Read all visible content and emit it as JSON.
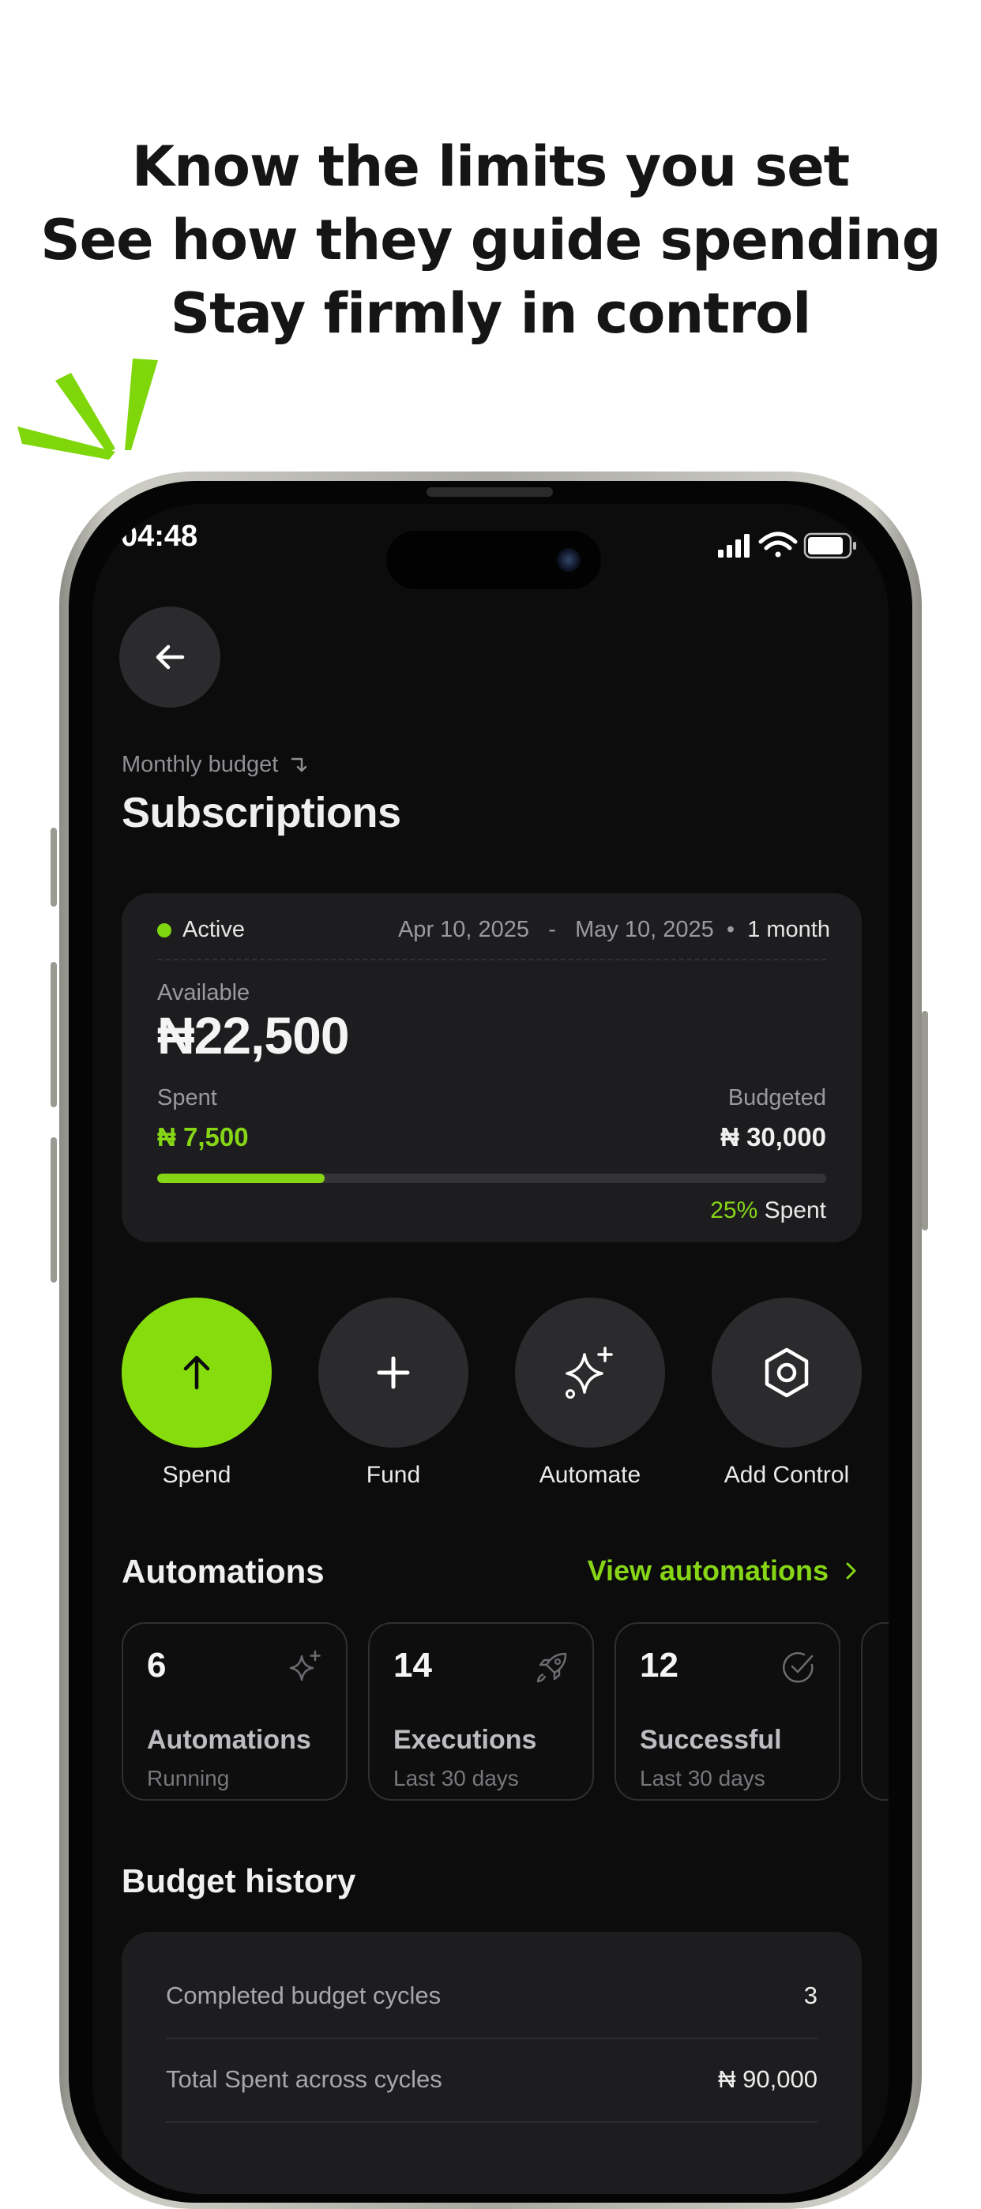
{
  "headline": {
    "line1": "Know the limits you set",
    "line2": "See how they guide spending",
    "line3": "Stay firmly in control"
  },
  "colors": {
    "accent": "#86d616",
    "background": "#0c0c0d",
    "card": "#1d1d1f"
  },
  "status_bar": {
    "time": "04:48",
    "icons": [
      "cellular-signal-icon",
      "wifi-icon",
      "battery-icon"
    ]
  },
  "nav": {
    "back_icon": "arrow-left-icon"
  },
  "header": {
    "breadcrumb": "Monthly budget",
    "breadcrumb_icon": "return-arrow-icon",
    "title": "Subscriptions"
  },
  "budget": {
    "status": "Active",
    "start_date": "Apr 10, 2025",
    "date_separator": "-",
    "end_date": "May 10, 2025",
    "duration_separator": "•",
    "duration": "1 month",
    "available_label": "Available",
    "available": "₦22,500",
    "spent_label": "Spent",
    "spent": "₦ 7,500",
    "budgeted_label": "Budgeted",
    "budgeted": "₦ 30,000",
    "progress_fraction": 0.25,
    "progress_percent": "25%",
    "progress_suffix": "Spent"
  },
  "actions": [
    {
      "label": "Spend",
      "icon": "arrow-up-icon"
    },
    {
      "label": "Fund",
      "icon": "plus-icon"
    },
    {
      "label": "Automate",
      "icon": "sparkles-icon"
    },
    {
      "label": "Add Control",
      "icon": "hexagon-settings-icon"
    }
  ],
  "automations": {
    "title": "Automations",
    "link": "View automations",
    "cards": [
      {
        "value": "6",
        "name": "Automations",
        "sub": "Running",
        "icon": "sparkles-icon"
      },
      {
        "value": "14",
        "name": "Executions",
        "sub": "Last 30 days",
        "icon": "rocket-icon"
      },
      {
        "value": "12",
        "name": "Successful",
        "sub": "Last 30 days",
        "icon": "check-circle-icon"
      }
    ]
  },
  "history": {
    "title": "Budget history",
    "rows": [
      {
        "label": "Completed budget cycles",
        "value": "3"
      },
      {
        "label": "Total Spent across cycles",
        "value": "₦ 90,000"
      }
    ]
  }
}
